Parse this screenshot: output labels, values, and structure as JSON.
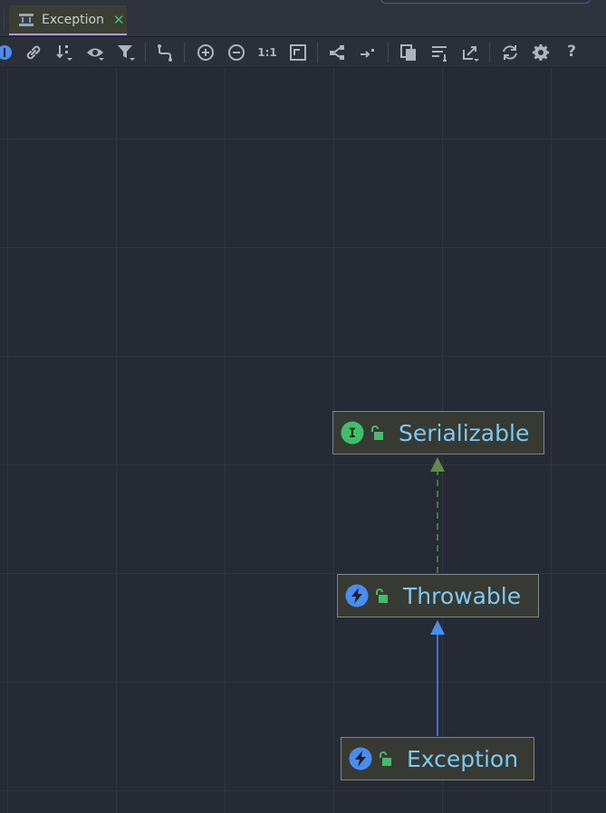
{
  "tab": {
    "label": "Exception",
    "close_glyph": "✕"
  },
  "toolbar": {
    "zoom_actual_label": "1:1",
    "help_label": "?",
    "icons": [
      "interface-icon",
      "link-icon",
      "sort-icon",
      "visibility-icon",
      "filter-icon",
      "route-edges-icon",
      "zoom-in-icon",
      "zoom-out-icon",
      "actual-size-icon",
      "fit-content-icon",
      "layout-icon",
      "connector-icon",
      "copy-icon",
      "align-icon",
      "export-icon",
      "refresh-icon",
      "settings-icon",
      "help-icon"
    ]
  },
  "diagram": {
    "nodes": [
      {
        "id": "serializable",
        "label": "Serializable",
        "kind": "interface",
        "kind_glyph": "I",
        "kind_color": "#3fbf6a"
      },
      {
        "id": "throwable",
        "label": "Throwable",
        "kind": "class",
        "kind_color": "#4a8df0"
      },
      {
        "id": "exception",
        "label": "Exception",
        "kind": "class",
        "kind_color": "#4a8df0"
      }
    ],
    "edges": [
      {
        "from": "throwable",
        "to": "serializable",
        "type": "implements",
        "style": "dashed",
        "color": "#5d8a4e"
      },
      {
        "from": "exception",
        "to": "throwable",
        "type": "extends",
        "style": "solid",
        "color": "#4a8df0"
      }
    ],
    "lock_color": "#3fbf6a",
    "label_color": "#7ec9f2"
  }
}
